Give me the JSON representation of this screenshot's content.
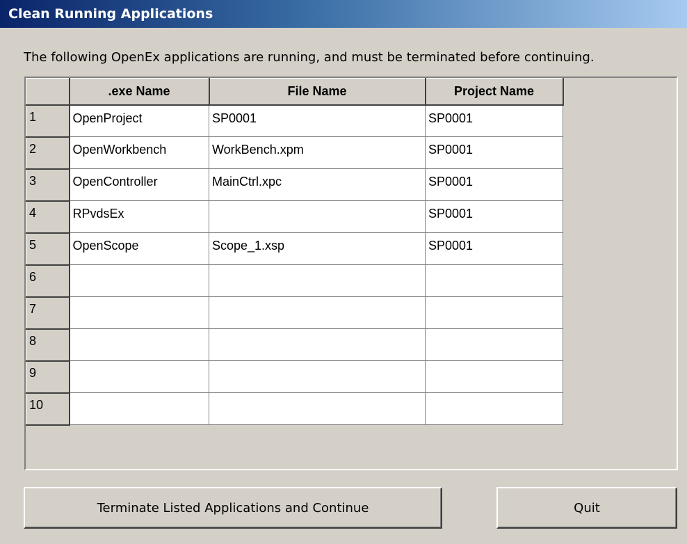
{
  "window": {
    "title": "Clean Running Applications"
  },
  "message": "The following OpenEx applications are running, and must be terminated before continuing.",
  "table": {
    "columns": [
      ".exe Name",
      "File Name",
      "Project Name"
    ],
    "rows": [
      {
        "num": "1",
        "exe": "OpenProject",
        "file": "SP0001",
        "project": "SP0001"
      },
      {
        "num": "2",
        "exe": "OpenWorkbench",
        "file": "WorkBench.xpm",
        "project": "SP0001"
      },
      {
        "num": "3",
        "exe": "OpenController",
        "file": "MainCtrl.xpc",
        "project": "SP0001"
      },
      {
        "num": "4",
        "exe": "RPvdsEx",
        "file": "",
        "project": "SP0001"
      },
      {
        "num": "5",
        "exe": "OpenScope",
        "file": "Scope_1.xsp",
        "project": "SP0001"
      },
      {
        "num": "6",
        "exe": "",
        "file": "",
        "project": ""
      },
      {
        "num": "7",
        "exe": "",
        "file": "",
        "project": ""
      },
      {
        "num": "8",
        "exe": "",
        "file": "",
        "project": ""
      },
      {
        "num": "9",
        "exe": "",
        "file": "",
        "project": ""
      },
      {
        "num": "10",
        "exe": "",
        "file": "",
        "project": ""
      }
    ]
  },
  "buttons": {
    "terminate": "Terminate Listed Applications and Continue",
    "quit": "Quit"
  },
  "colors": {
    "titlebar_start": "#0a246a",
    "titlebar_end": "#a6caf0",
    "face": "#d4d0c8"
  }
}
